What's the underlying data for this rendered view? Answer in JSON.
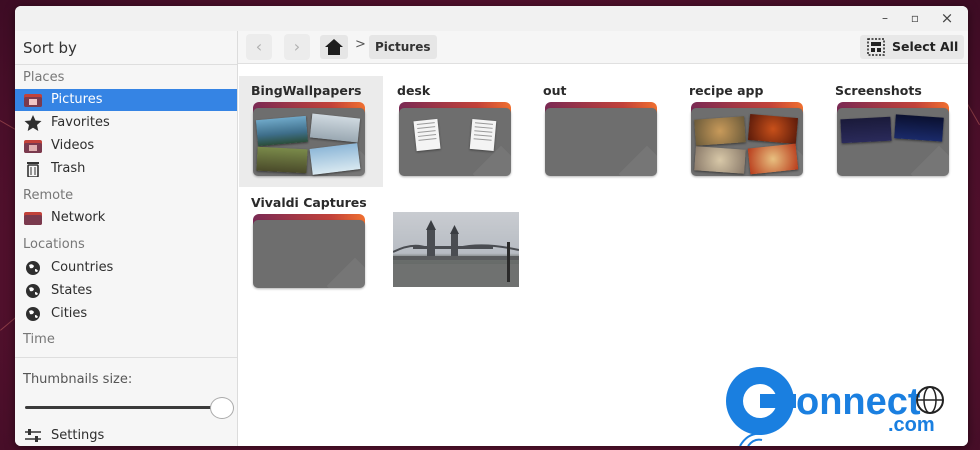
{
  "window": {
    "controls": {
      "minimize": "–",
      "maximize": "▫",
      "close": "×"
    }
  },
  "sidebar": {
    "sort_by": "Sort by",
    "sections": {
      "places": "Places",
      "remote": "Remote",
      "locations": "Locations",
      "time": "Time"
    },
    "places": [
      {
        "label": "Pictures",
        "icon": "pictures-folder-icon",
        "active": true
      },
      {
        "label": "Favorites",
        "icon": "star-icon"
      },
      {
        "label": "Videos",
        "icon": "videos-folder-icon"
      },
      {
        "label": "Trash",
        "icon": "trash-icon"
      }
    ],
    "remote": [
      {
        "label": "Network",
        "icon": "network-folder-icon"
      }
    ],
    "locations": [
      {
        "label": "Countries",
        "icon": "globe-icon"
      },
      {
        "label": "States",
        "icon": "globe-icon"
      },
      {
        "label": "Cities",
        "icon": "globe-icon"
      }
    ],
    "thumbnails_size_label": "Thumbnails size:",
    "thumbnails_size_value": 1.0,
    "settings_label": "Settings"
  },
  "toolbar": {
    "back": "‹",
    "forward": "›",
    "breadcrumb_current": "Pictures",
    "breadcrumb_sep": ">",
    "select_all": "Select All"
  },
  "items": [
    {
      "name": "BingWallpapers",
      "kind": "folder-photos",
      "selected": true
    },
    {
      "name": "desk",
      "kind": "folder-docs"
    },
    {
      "name": "out",
      "kind": "folder-empty"
    },
    {
      "name": "recipe app",
      "kind": "folder-food"
    },
    {
      "name": "Screenshots",
      "kind": "folder-screens"
    },
    {
      "name": "Vivaldi Captures",
      "kind": "folder-empty"
    },
    {
      "name": "",
      "kind": "photo-tower-bridge"
    }
  ],
  "colors": {
    "accent": "#3584e4",
    "folder_body": "#6e6e6e",
    "folder_tab": "#c2423a"
  }
}
